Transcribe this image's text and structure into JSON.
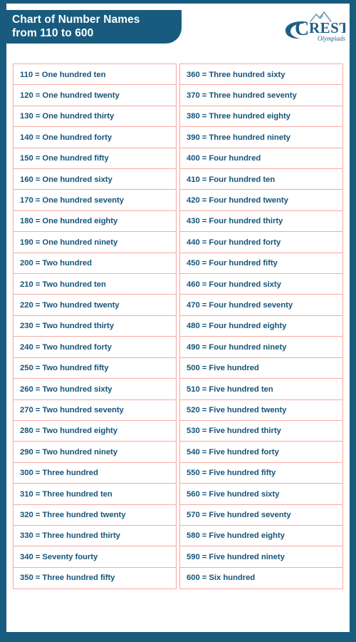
{
  "header": {
    "title": "Chart of Number Names\nfrom 110 to 600",
    "logo": {
      "brand": "CREST",
      "brand_initial": "C",
      "brand_rest": "REST",
      "tagline": "Olympiads",
      "color": "#1f5f84"
    }
  },
  "theme": {
    "frame_color": "#195b7e",
    "banner_color": "#195b7e",
    "cell_border_color": "#f9a9a1",
    "cell_text_color": "#17547a",
    "title_text_color": "#ffffff",
    "page_background": "#ffffff"
  },
  "chart_data": {
    "type": "table",
    "title": "Chart of Number Names from 110 to 600",
    "columns": 2,
    "rows_per_column": 25,
    "left_column": [
      "110 = One hundred ten",
      "120 = One hundred twenty",
      "130 = One hundred thirty",
      "140 = One hundred forty",
      "150 = One hundred fifty",
      "160 = One hundred sixty",
      "170 = One hundred seventy",
      "180 = One hundred eighty",
      "190 = One hundred ninety",
      "200 = Two hundred",
      "210 = Two hundred ten",
      "220 = Two hundred twenty",
      "230 = Two hundred thirty",
      "240 = Two hundred forty",
      "250 = Two hundred fifty",
      "260 = Two hundred sixty",
      "270 = Two hundred seventy",
      "280 = Two hundred eighty",
      "290 = Two hundred ninety",
      "300 = Three hundred",
      "310 = Three hundred ten",
      "320 = Three hundred twenty",
      "330 = Three hundred thirty",
      "340 = Seventy fourty",
      "350 = Three hundred fifty"
    ],
    "right_column": [
      "360 = Three hundred sixty",
      "370 = Three hundred seventy",
      "380 = Three hundred eighty",
      "390 = Three hundred ninety",
      "400 = Four hundred",
      "410 = Four hundred ten",
      "420 = Four hundred twenty",
      "430 = Four hundred thirty",
      "440 = Four hundred forty",
      "450 = Four hundred fifty",
      "460 = Four hundred sixty",
      "470 = Four hundred seventy",
      "480 = Four hundred eighty",
      "490 = Four hundred ninety",
      "500 = Five hundred",
      "510 = Five hundred ten",
      "520 = Five hundred twenty",
      "530 = Five hundred thirty",
      "540 = Five hundred forty",
      "550 = Five hundred fifty",
      "560 = Five hundred sixty",
      "570 = Five hundred seventy",
      "580 = Five hundred eighty",
      "590 = Five hundred ninety",
      "600 = Six hundred"
    ]
  }
}
